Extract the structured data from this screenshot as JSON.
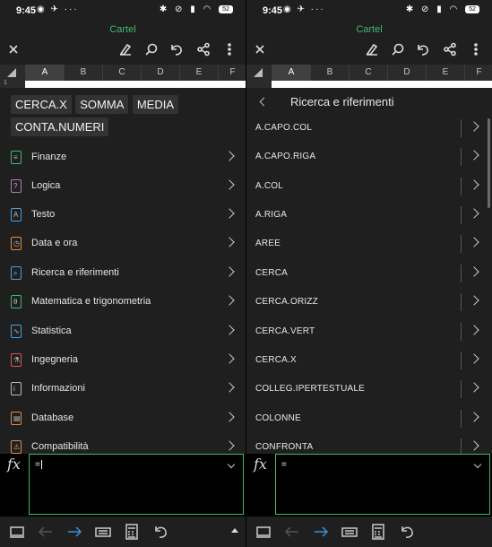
{
  "status": {
    "time": "9:45",
    "battery": "52"
  },
  "app": {
    "title": "Cartel"
  },
  "columns": [
    "A",
    "B",
    "C",
    "D",
    "E",
    "F"
  ],
  "row_number": "1",
  "recent_functions": [
    "CERCA.X",
    "SOMMA",
    "MEDIA",
    "CONTA.NUMERI"
  ],
  "categories": [
    {
      "label": "Finanze",
      "icon": "finance-icon"
    },
    {
      "label": "Logica",
      "icon": "logic-icon"
    },
    {
      "label": "Testo",
      "icon": "text-icon"
    },
    {
      "label": "Data e ora",
      "icon": "date-time-icon"
    },
    {
      "label": "Ricerca e riferimenti",
      "icon": "lookup-icon"
    },
    {
      "label": "Matematica e trigonometria",
      "icon": "math-icon"
    },
    {
      "label": "Statistica",
      "icon": "statistics-icon"
    },
    {
      "label": "Ingegneria",
      "icon": "engineering-icon"
    },
    {
      "label": "Informazioni",
      "icon": "info-icon"
    },
    {
      "label": "Database",
      "icon": "database-icon"
    },
    {
      "label": "Compatibilità",
      "icon": "compatibility-icon"
    }
  ],
  "lookup": {
    "title": "Ricerca e riferimenti",
    "functions": [
      "A.CAPO.COL",
      "A.CAPO.RIGA",
      "A.COL",
      "A.RIGA",
      "AREE",
      "CERCA",
      "CERCA.ORIZZ",
      "CERCA.VERT",
      "CERCA.X",
      "COLLEG.IPERTESTUALE",
      "COLONNE",
      "CONFRONTA"
    ]
  },
  "formula": {
    "fx_label": "fx",
    "value": "="
  },
  "colors": {
    "accent": "#3fb96c",
    "nav_arrow": "#3b8fd9"
  }
}
